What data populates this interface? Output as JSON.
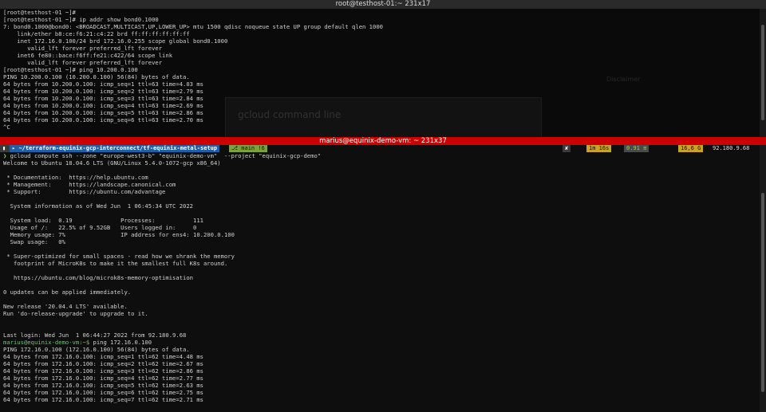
{
  "window_top": {
    "title": "root@testhost-01:~ 231x17"
  },
  "window_bottom": {
    "title": "marius@equinix-demo-vm: ~ 231x37"
  },
  "background_window": {
    "title": "gcloud command line",
    "side_label": "Disclaimer"
  },
  "top_terminal": {
    "lines": [
      "[root@testhost-01 ~]#",
      "[root@testhost-01 ~]# ip addr show bond0.1000",
      "7: bond0.1000@bond0: <BROADCAST,MULTICAST,UP,LOWER_UP> mtu 1500 qdisc noqueue state UP group default qlen 1000",
      "    link/ether b8:ce:f6:21:c4:22 brd ff:ff:ff:ff:ff:ff",
      "    inet 172.16.0.100/24 brd 172.16.0.255 scope global bond0.1000",
      "       valid_lft forever preferred_lft forever",
      "    inet6 fe80::bace:f6ff:fe21:c422/64 scope link",
      "       valid_lft forever preferred_lft forever",
      "[root@testhost-01 ~]# ping 10.200.0.100",
      "PING 10.200.0.100 (10.200.0.100) 56(84) bytes of data.",
      "64 bytes from 10.200.0.100: icmp_seq=1 ttl=63 time=4.03 ms",
      "64 bytes from 10.200.0.100: icmp_seq=2 ttl=63 time=2.79 ms",
      "64 bytes from 10.200.0.100: icmp_seq=3 ttl=63 time=2.84 ms",
      "64 bytes from 10.200.0.100: icmp_seq=4 ttl=63 time=2.69 ms",
      "64 bytes from 10.200.0.100: icmp_seq=5 ttl=63 time=2.86 ms",
      "64 bytes from 10.200.0.100: icmp_seq=6 ttl=63 time=2.70 ms",
      "^C"
    ]
  },
  "prompt_bar": {
    "os_icon": "terminal-icon",
    "path": "~/terraform-equinix-gcp-interconnect/tf-equinix-metal-setup",
    "git": "main !6",
    "status": "✘",
    "duration": "1m 16s",
    "load": "0.91",
    "memory": "16,6 G",
    "ip": "92.180.9.68"
  },
  "bottom_terminal": {
    "command": "gcloud compute ssh --zone \"europe-west3-b\" \"equinix-demo-vm\"  --project \"equinix-gcp-demo\"",
    "lines": [
      "Welcome to Ubuntu 18.04.6 LTS (GNU/Linux 5.4.0-1072-gcp x86_64)",
      "",
      " * Documentation:  https://help.ubuntu.com",
      " * Management:     https://landscape.canonical.com",
      " * Support:        https://ubuntu.com/advantage",
      "",
      "  System information as of Wed Jun  1 06:45:34 UTC 2022",
      "",
      "  System load:  0.19              Processes:           111",
      "  Usage of /:   22.5% of 9.52GB   Users logged in:     0",
      "  Memory usage: 7%                IP address for ens4: 10.200.0.100",
      "  Swap usage:   0%",
      "",
      " * Super-optimized for small spaces - read how we shrank the memory",
      "   footprint of MicroK8s to make it the smallest full K8s around.",
      "",
      "   https://ubuntu.com/blog/microk8s-memory-optimisation",
      "",
      "0 updates can be applied immediately.",
      "",
      "New release '20.04.4 LTS' available.",
      "Run 'do-release-upgrade' to upgrade to it.",
      "",
      "",
      "Last login: Wed Jun  1 06:44:27 2022 from 92.180.9.68"
    ],
    "prompt": "marius@equinix-demo-vm:~$",
    "prompt_command": " ping 172.16.0.100",
    "ping_lines": [
      "PING 172.16.0.100 (172.16.0.100) 56(84) bytes of data.",
      "64 bytes from 172.16.0.100: icmp_seq=1 ttl=62 time=4.48 ms",
      "64 bytes from 172.16.0.100: icmp_seq=2 ttl=62 time=2.67 ms",
      "64 bytes from 172.16.0.100: icmp_seq=3 ttl=62 time=2.86 ms",
      "64 bytes from 172.16.0.100: icmp_seq=4 ttl=62 time=2.77 ms",
      "64 bytes from 172.16.0.100: icmp_seq=5 ttl=62 time=2.63 ms",
      "64 bytes from 172.16.0.100: icmp_seq=6 ttl=62 time=2.75 ms",
      "64 bytes from 172.16.0.100: icmp_seq=7 ttl=62 time=2.71 ms"
    ]
  },
  "colors": {
    "alert_bar": "#cc0000",
    "prompt_path": "#1e5fa8",
    "prompt_git": "#7aa33a",
    "prompt_warn": "#c9a227"
  }
}
